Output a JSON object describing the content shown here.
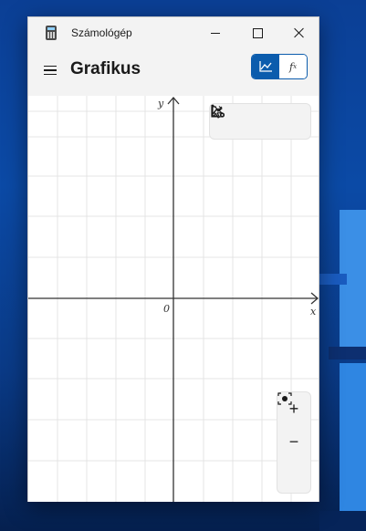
{
  "window": {
    "app_title": "Számológép",
    "app_icon": "calculator-icon",
    "controls": {
      "minimize": "minimize-icon",
      "maximize": "maximize-icon",
      "close": "close-icon"
    }
  },
  "header": {
    "menu_icon": "hamburger-icon",
    "title": "Grafikus",
    "mode_toggle": {
      "graph_icon": "graph-icon",
      "function_label": "f",
      "function_subscript": "x",
      "selected": "graph"
    }
  },
  "graph": {
    "x_axis_label": "x",
    "y_axis_label": "y",
    "origin_label": "0",
    "toolbar": [
      "select-cursor-icon",
      "share-icon",
      "graph-settings-icon"
    ],
    "zoom": {
      "zoom_in": "+",
      "zoom_out": "−",
      "reset": "fit-view-icon"
    }
  },
  "colors": {
    "accent": "#0b5cad",
    "grid": "#e4e4e4",
    "axis": "#333333"
  }
}
